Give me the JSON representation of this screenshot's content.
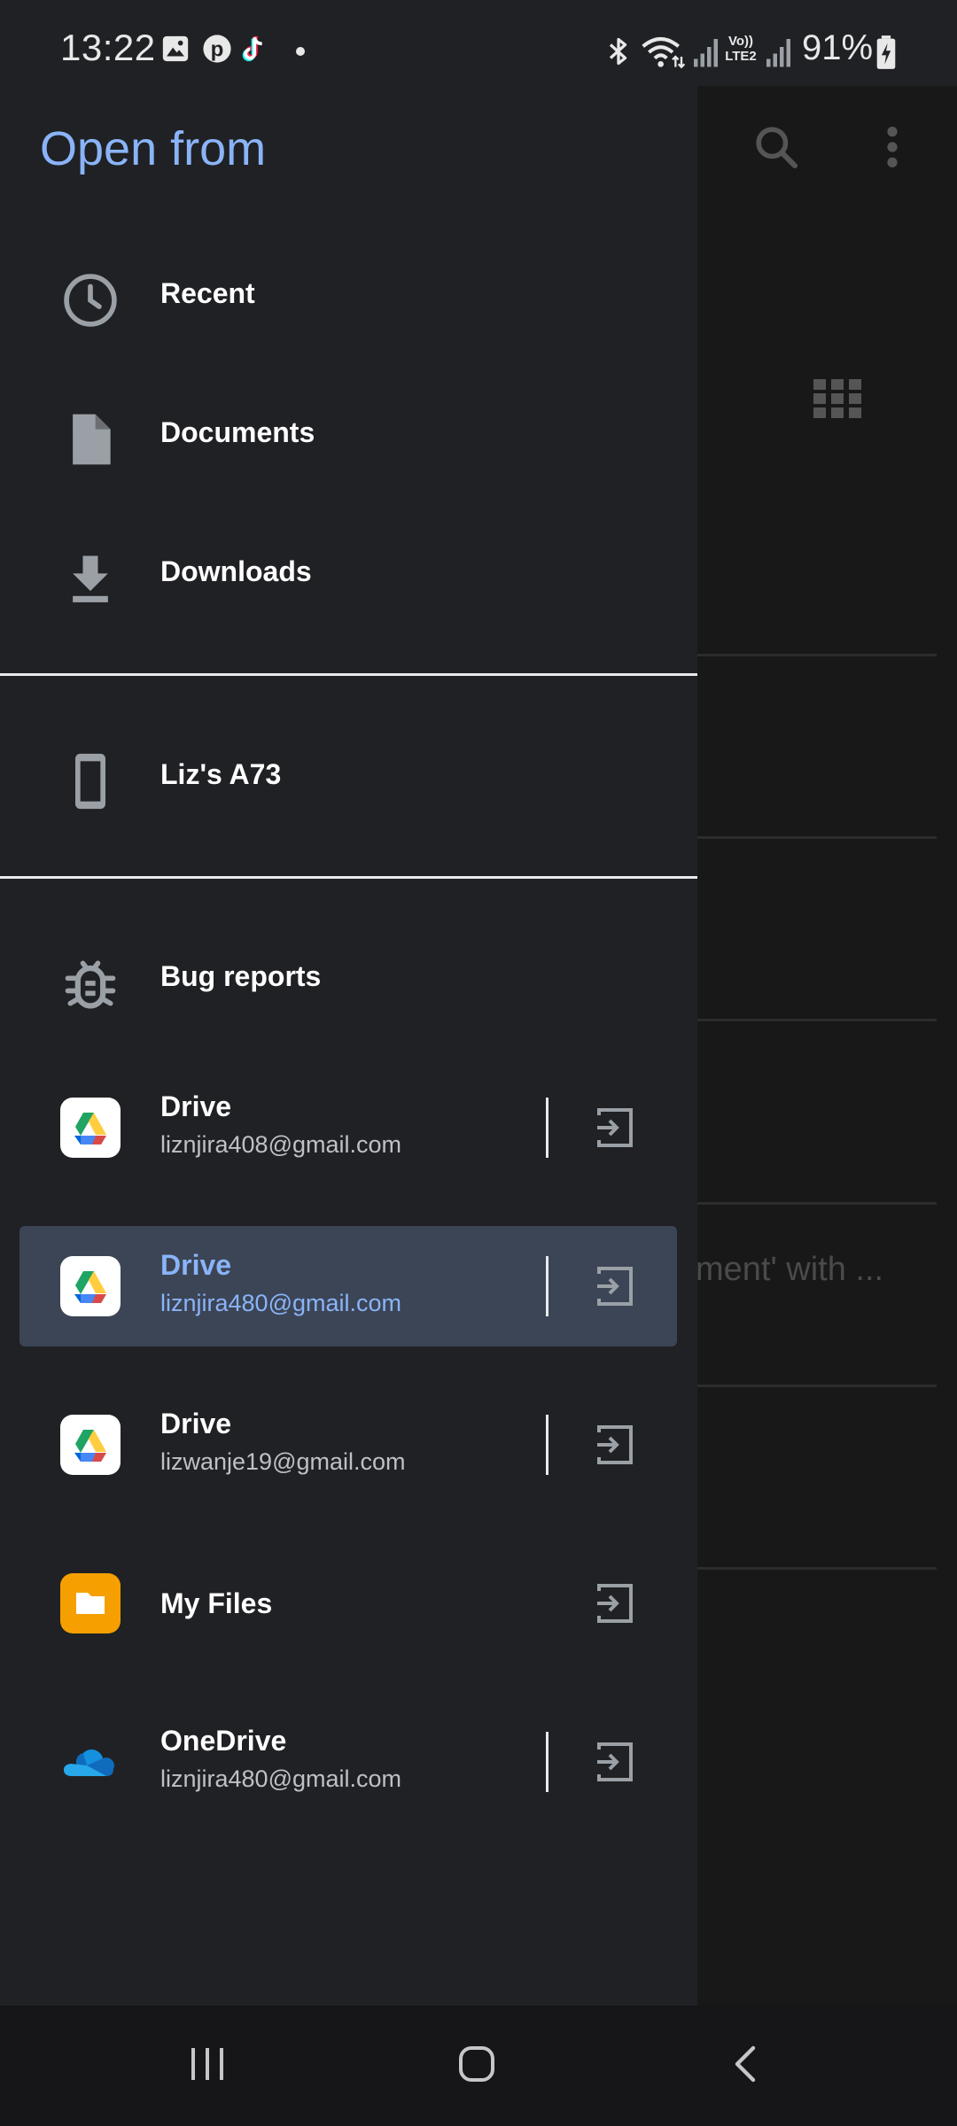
{
  "status_bar": {
    "time": "13:22",
    "battery": "91%",
    "left_icons": [
      "gallery-icon",
      "pinterest-icon",
      "tiktok-icon",
      "dot-icon"
    ],
    "right_icons": [
      "bluetooth-icon",
      "wifi-icon",
      "signal-icon",
      "volte-icon",
      "signal-icon",
      "battery-icon"
    ],
    "volte_label": "Vo)) LTE2"
  },
  "drawer": {
    "title": "Open from",
    "nav": [
      {
        "label": "Recent",
        "icon": "clock-icon"
      },
      {
        "label": "Documents",
        "icon": "document-icon"
      },
      {
        "label": "Downloads",
        "icon": "download-icon"
      },
      {
        "label": "Liz's A73",
        "icon": "phone-icon"
      },
      {
        "label": "Bug reports",
        "icon": "bug-icon"
      }
    ],
    "accounts": [
      {
        "label": "Drive",
        "sub": "liznjira408@gmail.com",
        "icon": "google-drive-icon",
        "selected": false
      },
      {
        "label": "Drive",
        "sub": "liznjira480@gmail.com",
        "icon": "google-drive-icon",
        "selected": true
      },
      {
        "label": "Drive",
        "sub": "lizwanje19@gmail.com",
        "icon": "google-drive-icon",
        "selected": false
      },
      {
        "label": "My Files",
        "sub": "",
        "icon": "folder-icon",
        "selected": false
      },
      {
        "label": "OneDrive",
        "sub": "liznjira480@gmail.com",
        "icon": "onedrive-icon",
        "selected": false
      }
    ]
  },
  "background": {
    "partial_text": "ment' with ...",
    "icons": [
      "search-icon",
      "more-vert-icon",
      "grid-view-icon"
    ]
  },
  "colors": {
    "accent": "#8ab4f8",
    "drawer_bg": "#202124",
    "selected_bg": "#3c4556",
    "myfiles_orange": "#f5a000",
    "onedrive_blue": "#0f6cbd"
  },
  "nav_bar": {
    "buttons": [
      "recent-apps-icon",
      "home-icon",
      "back-icon"
    ]
  }
}
